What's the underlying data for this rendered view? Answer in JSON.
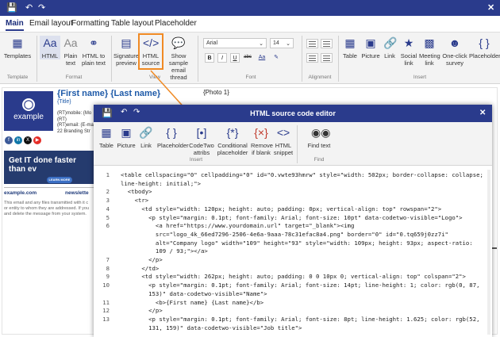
{
  "app": {
    "close": "✕"
  },
  "tabs": [
    {
      "label": "Main"
    },
    {
      "label": "Email layout"
    },
    {
      "label": "Formatting"
    },
    {
      "label": "Table layout"
    },
    {
      "label": "Placeholder"
    }
  ],
  "ribbon": {
    "templates": "Templates",
    "html": "HTML",
    "plain_text": "Plain text",
    "html_to_plain": "HTML to plain text",
    "signature_preview": "Signature preview",
    "html_source": "HTML source",
    "show_sample": "Show sample email thread",
    "font_name": "Arial",
    "font_size": "14",
    "bold": "B",
    "italic": "I",
    "underline": "U",
    "strike": "abc",
    "font_color": "Aa",
    "table": "Table",
    "picture": "Picture",
    "link": "Link",
    "social_link": "Social link",
    "meeting_link": "Meeting link",
    "survey": "One-click survey",
    "placeholder": "Placeholder",
    "groups": {
      "template": "Template",
      "format": "Format",
      "view": "View",
      "font": "Font",
      "alignment": "Alignment",
      "insert": "Insert"
    }
  },
  "signature": {
    "name": "{First name} {Last name}",
    "title_ph": "{Title}",
    "photo": "{Photo 1}",
    "logo_text": "example",
    "line1": "(RT)mobile: {Mo",
    "line2": "(RT)",
    "line3": "(RT)email: {E-ma",
    "line4": "22 Branding Str",
    "banner": "Get IT done faster than ev",
    "banner_btn": "LEARN MORE",
    "domain": "example.com",
    "news": "newslette",
    "disclaimer1": "This email and any files transmitted with it c",
    "disclaimer2": "or entity to whom they are addressed. If you",
    "disclaimer3": "and delete the message from your system."
  },
  "dialog": {
    "title": "HTML source code editor",
    "close": "✕",
    "buttons": {
      "table": "Table",
      "picture": "Picture",
      "link": "Link",
      "placeholder": "Placeholder",
      "codetwo": "CodeTwo attribs",
      "conditional": "Conditional placeholder",
      "remove": "Remove if blank",
      "snippet": "HTML snippet",
      "find": "Find text"
    },
    "groups": {
      "insert": "Insert",
      "find": "Find"
    },
    "code": [
      {
        "n": "1",
        "text": "<table cellspacing=\"0\" cellpadding=\"0\" id=\"0.vwte93hmrw\" style=\"width: 502px; border-collapse: collapse;"
      },
      {
        "n": "",
        "text": "line-height: initial;\">"
      },
      {
        "n": "2",
        "text": "  <tbody>"
      },
      {
        "n": "3",
        "text": "    <tr>"
      },
      {
        "n": "4",
        "text": "      <td style=\"width: 120px; height: auto; padding: 0px; vertical-align: top\" rowspan=\"2\">"
      },
      {
        "n": "5",
        "text": "        <p style=\"margin: 0.1pt; font-family: Arial; font-size: 10pt\" data-codetwo-visible=\"Logo\">"
      },
      {
        "n": "6",
        "text": "          <a href=\"https://www.yourdomain.url\" target=\"_blank\"><img"
      },
      {
        "n": "",
        "text": "          src=\"logo_4k_66ed7296-2506-4e6a-9aaa-78c31efac8a4.png\" border=\"0\" id=\"0.tq659j0zz7i\""
      },
      {
        "n": "",
        "text": "          alt=\"Company logo\" width=\"109\" height=\"93\" style=\"width: 109px; height: 93px; aspect-ratio:"
      },
      {
        "n": "",
        "text": "          109 / 93;\"></a>"
      },
      {
        "n": "7",
        "text": "        </p>"
      },
      {
        "n": "8",
        "text": "      </td>"
      },
      {
        "n": "9",
        "text": "      <td style=\"width: 262px; height: auto; padding: 0 0 10px 0; vertical-align: top\" colspan=\"2\">"
      },
      {
        "n": "10",
        "text": "        <p style=\"margin: 0.1pt; font-family: Arial; font-size: 14pt; line-height: 1; color: rgb(0, 87,"
      },
      {
        "n": "",
        "text": "        153)\" data-codetwo-visible=\"Name\">"
      },
      {
        "n": "11",
        "text": "          <b>{First name} {Last name}</b>"
      },
      {
        "n": "12",
        "text": "        </p>"
      },
      {
        "n": "13",
        "text": "        <p style=\"margin: 0.1pt; font-family: Arial; font-size: 8pt; line-height: 1.625; color: rgb(52,"
      },
      {
        "n": "",
        "text": "        131, 159)\" data-codetwo-visible=\"Job title\">"
      }
    ]
  }
}
